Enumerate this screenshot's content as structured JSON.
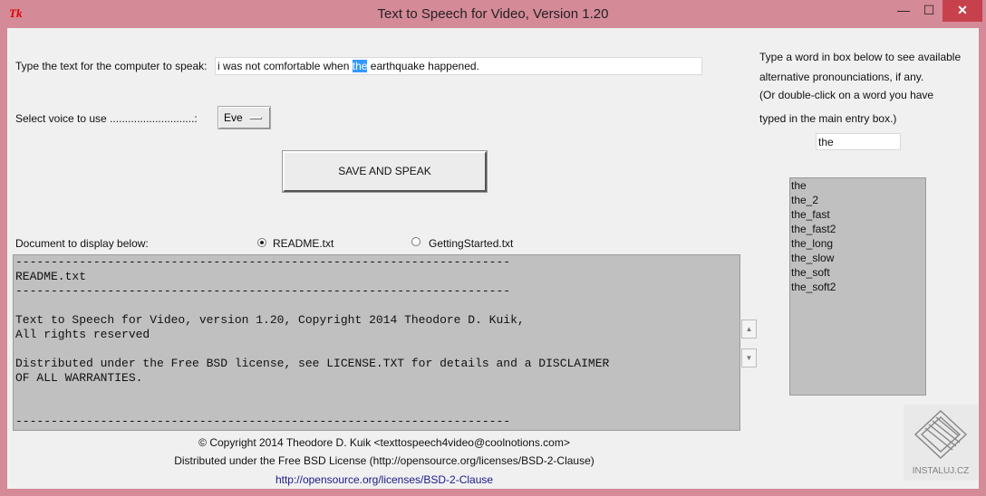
{
  "window": {
    "logo_text": "Tk",
    "title": "Text to Speech for Video, Version 1.20",
    "min_glyph": "—",
    "max_glyph": "☐",
    "close_glyph": "✕"
  },
  "main": {
    "text_label": "Type the text for the computer to speak:",
    "text_before": "i was not comfortable when ",
    "text_selected": "the",
    "text_after": " earthquake happened.",
    "voice_label": "Select voice to use ............................:",
    "voice_value": "Eve",
    "save_speak_label": "SAVE AND SPEAK",
    "doc_label": "Document to display below:",
    "radio_options": [
      {
        "label": "README.txt",
        "selected": true
      },
      {
        "label": "GettingStarted.txt",
        "selected": false
      }
    ],
    "document_lines": [
      "----------------------------------------------------------------------",
      "README.txt",
      "----------------------------------------------------------------------",
      "",
      "Text to Speech for Video, version 1.20, Copyright 2014 Theodore D. Kuik,",
      "All rights reserved",
      "",
      "Distributed under the Free BSD license, see LICENSE.TXT for details and a DISCLAIMER",
      "OF ALL WARRANTIES.",
      "",
      "",
      "----------------------------------------------------------------------"
    ],
    "scroll_up_glyph": "▲",
    "scroll_down_glyph": "▼"
  },
  "side": {
    "instructions": [
      "Type a word in box below to see available",
      "alternative pronounciations, if any.",
      "(Or double-click on a word you have",
      "typed in the main entry box.)"
    ],
    "word_value": "the",
    "alternatives": [
      "the",
      "the_2",
      "the_fast",
      "the_fast2",
      "the_long",
      "the_slow",
      "the_soft",
      "the_soft2"
    ]
  },
  "footer": {
    "copyright": "© Copyright 2014 Theodore D. Kuik <texttospeech4video@coolnotions.com>",
    "license": "Distributed under the Free BSD License (http://opensource.org/licenses/BSD-2-Clause)",
    "link": "http://opensource.org/licenses/BSD-2-Clause"
  },
  "watermark": {
    "text": "INSTALUJ.CZ"
  }
}
